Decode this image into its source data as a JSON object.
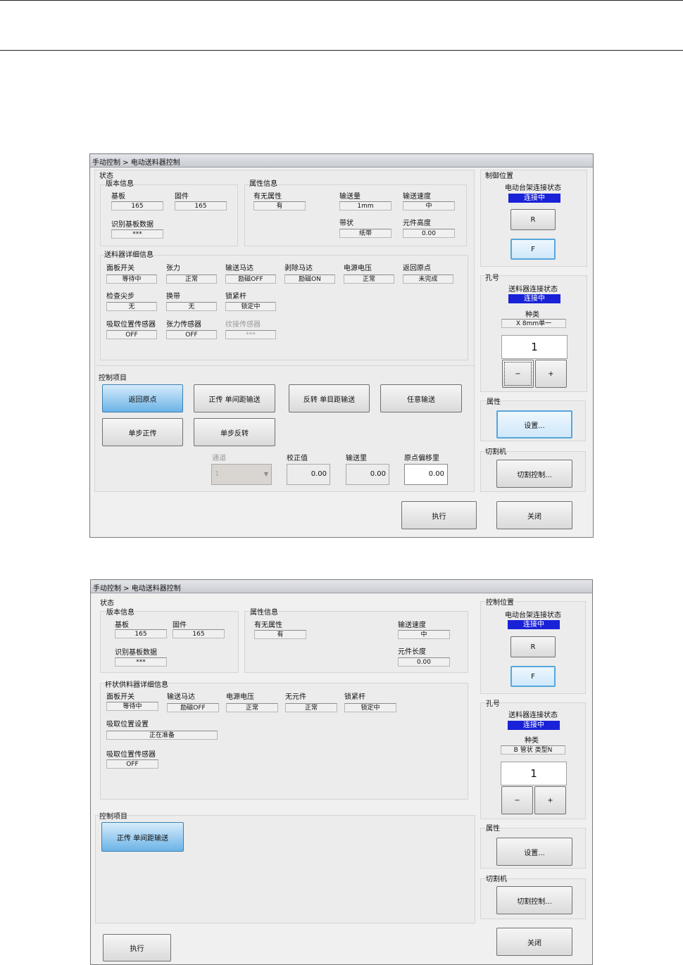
{
  "dlg1": {
    "title": "手动控制 > 电动送料器控制",
    "status_group": "状态",
    "version": {
      "title": "版本信息",
      "board_label": "基板",
      "board_value": "165",
      "firmware_label": "固件",
      "firmware_value": "165",
      "id_label": "识别基板数据",
      "id_value": "***"
    },
    "attr": {
      "title": "属性信息",
      "has_attr_label": "有无属性",
      "has_attr_value": "有",
      "feed_amount_label": "输送量",
      "feed_amount_value": "1mm",
      "feed_speed_label": "输送速度",
      "feed_speed_value": "中",
      "tape_label": "带状",
      "tape_value": "纸带",
      "height_label": "元件高度",
      "height_value": "0.00"
    },
    "detail": {
      "title": "送料器详细信息",
      "row1": [
        {
          "label": "面板开关",
          "value": "等待中"
        },
        {
          "label": "张力",
          "value": "正常"
        },
        {
          "label": "输送马达",
          "value": "励磁OFF"
        },
        {
          "label": "剥除马达",
          "value": "励磁ON"
        },
        {
          "label": "电源电压",
          "value": "正常"
        },
        {
          "label": "返回原点",
          "value": "未完成"
        }
      ],
      "row2": [
        {
          "label": "检查尖步",
          "value": "无"
        },
        {
          "label": "换带",
          "value": "无"
        },
        {
          "label": "锁紧杆",
          "value": "锁定中"
        }
      ],
      "row3": [
        {
          "label": "吸取位置传感器",
          "value": "OFF"
        },
        {
          "label": "张力传感器",
          "value": "OFF"
        },
        {
          "label": "纹接传感器",
          "value": "***"
        }
      ]
    },
    "control": {
      "title": "控制项目",
      "btn_home": "返回原点",
      "btn_fwd": "正传 单间距输送",
      "btn_rev": "反转 单目距输送",
      "btn_any": "任意输送",
      "btn_step_fwd": "单步正传",
      "btn_step_rev": "单步反转",
      "channel_label": "通道",
      "channel_value": "1",
      "correction_label": "校正值",
      "correction_value": "0.00",
      "feed_label": "输送里",
      "feed_value": "0.00",
      "offset_label": "原点偏移里",
      "offset_value": "0.00"
    },
    "ctrlpos": {
      "title": "制御位置",
      "conn_label": "电动台架连接状态",
      "conn_status": "连接中",
      "btn_r": "R",
      "btn_f": "F"
    },
    "hole": {
      "title": "孔号",
      "feeder_conn_label": "送料器连接状态",
      "feeder_conn_status": "连接中",
      "type_label": "种类",
      "type_value": "X 8mm单一",
      "number": "1",
      "minus": "−",
      "plus": "+"
    },
    "prop": {
      "title": "属性",
      "btn": "设置..."
    },
    "cutter": {
      "title": "切割机",
      "btn": "切割控制..."
    },
    "btn_exec": "执行",
    "btn_close": "关闭"
  },
  "dlg2": {
    "title": "手动控制 > 电动送料器控制",
    "status_group": "状态",
    "version": {
      "title": "版本信息",
      "board_label": "基板",
      "board_value": "165",
      "firmware_label": "固件",
      "firmware_value": "165",
      "id_label": "识别基板数据",
      "id_value": "***"
    },
    "attr": {
      "title": "属性信息",
      "has_attr_label": "有无属性",
      "has_attr_value": "有",
      "feed_speed_label": "输送速度",
      "feed_speed_value": "中",
      "length_label": "元件长度",
      "length_value": "0.00"
    },
    "detail": {
      "title": "杆状供料器详细信息",
      "row1": [
        {
          "label": "面板开关",
          "value": "等待中"
        },
        {
          "label": "输送马达",
          "value": "励磁OFF"
        },
        {
          "label": "电源电压",
          "value": "正常"
        },
        {
          "label": "无元件",
          "value": "正常"
        },
        {
          "label": "锁紧杆",
          "value": "锁定中"
        }
      ],
      "pickup_setting_label": "吸取位置设置",
      "pickup_setting_value": "正在准备",
      "pickup_sensor_label": "吸取位置传感器",
      "pickup_sensor_value": "OFF"
    },
    "control": {
      "title": "控制项目",
      "btn_fwd": "正传 单间距输送"
    },
    "ctrlpos": {
      "title": "控制位置",
      "conn_label": "电动台架连接状态",
      "conn_status": "连接中",
      "btn_r": "R",
      "btn_f": "F"
    },
    "hole": {
      "title": "孔号",
      "feeder_conn_label": "送料器连接状态",
      "feeder_conn_status": "连接中",
      "type_label": "种类",
      "type_value": "B 管状 类型N",
      "number": "1",
      "minus": "−",
      "plus": "+"
    },
    "prop": {
      "title": "属性",
      "btn": "设置..."
    },
    "cutter": {
      "title": "切割机",
      "btn": "切割控制..."
    },
    "btn_exec": "执行",
    "btn_close": "关闭"
  }
}
